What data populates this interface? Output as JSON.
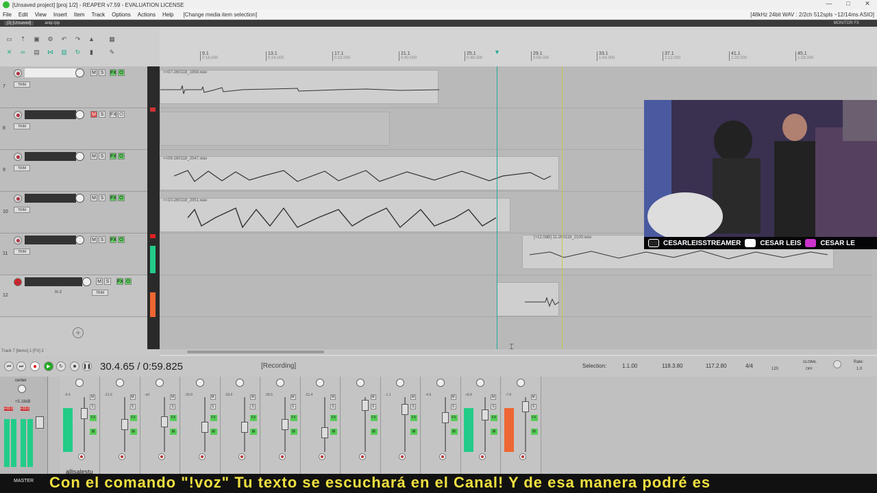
{
  "window": {
    "title": "[Unsaved project] [proj 1/2] - REAPER v7.59 - EVALUATION LICENSE",
    "controls": [
      "—",
      "□",
      "✕"
    ]
  },
  "menu": {
    "items": [
      "File",
      "Edit",
      "View",
      "Insert",
      "Item",
      "Track",
      "Options",
      "Actions",
      "Help"
    ],
    "selection_hint": "[Change media item selection]",
    "audio_info": "[48kHz 24bit WAV : 2/2ch 512spls ~12/14ms ASIO]"
  },
  "tabs": {
    "tab1": "[3] [Unsaved]",
    "tab2": "anqi.rpp",
    "monitor": "MONITOR FX"
  },
  "ruler": {
    "marks": [
      {
        "bar": "9.1",
        "time": "0:16.000"
      },
      {
        "bar": "13.1",
        "time": "0:24.000"
      },
      {
        "bar": "17.1",
        "time": "0:32.000"
      },
      {
        "bar": "21.1",
        "time": "0:40.000"
      },
      {
        "bar": "25.1",
        "time": "0:48.000"
      },
      {
        "bar": "29.1",
        "time": "0:56.000"
      },
      {
        "bar": "33.1",
        "time": "1:04.000"
      },
      {
        "bar": "37.1",
        "time": "1:12.000"
      },
      {
        "bar": "41.1",
        "time": "1:20.000"
      },
      {
        "bar": "45.1",
        "time": "1:28.000"
      }
    ]
  },
  "tracks": [
    {
      "num": "7",
      "trim": "TRIM",
      "item_label": "<<07-260118_1958.wav"
    },
    {
      "num": "8",
      "trim": "TRIM",
      "item_label": ""
    },
    {
      "num": "9",
      "trim": "TRIM",
      "item_label": "<<09-260118_2047.wav"
    },
    {
      "num": "10",
      "trim": "TRIM",
      "item_label": "<<10-260118_2051.wav"
    },
    {
      "num": "11",
      "trim": "TRIM",
      "item_label": "[+12.0dB] 11-260118_2100.wav"
    },
    {
      "num": "12",
      "trim": "TRIM",
      "input": "In 2",
      "item_label": ""
    }
  ],
  "buttons": {
    "mute": "M",
    "solo": "S",
    "fx": "FX"
  },
  "status": {
    "track_info": "Track 7 [items] 1 [FX] 2"
  },
  "transport": {
    "time": "30.4.65 / 0:59.825",
    "state": "[Recording]",
    "selection_label": "Selection:",
    "sel_start": "1.1.00",
    "sel_end": "118.3.80",
    "sel_len": "117.2.80",
    "time_sig": "4/4",
    "bpm": "120",
    "global": "GLOBAL",
    "global_state": "OFF",
    "rate_label": "Rate:",
    "rate": "1.0"
  },
  "mixer": {
    "master_label": "MASTER",
    "center": "center",
    "master_db": "+5.18dB",
    "master_peak_l": "+10.3",
    "master_peak_r": "+10.2",
    "strip_db": [
      "-9.6",
      "-21.6",
      "-inf",
      "-39.9",
      "-28.6",
      "-28.5",
      "-31.4",
      "",
      "-1.1",
      "-4.9",
      "+8.8",
      "-7.8"
    ],
    "channel_name": "allisalestu"
  },
  "webcam": {
    "tiktok": "CESARLEISSTREAMER",
    "youtube": "CESAR LEIS",
    "instagram": "CESAR LE"
  },
  "subtitle": {
    "text": "Con el comando \"!voz\"  Tu  texto  se  escuchará  en  el  Canal!   Y de esa manera podré es"
  },
  "colors": {
    "record": "#d42020",
    "play": "#22aa22",
    "fx_green": "#55cc55",
    "subtitle_yellow": "#f0e040"
  }
}
